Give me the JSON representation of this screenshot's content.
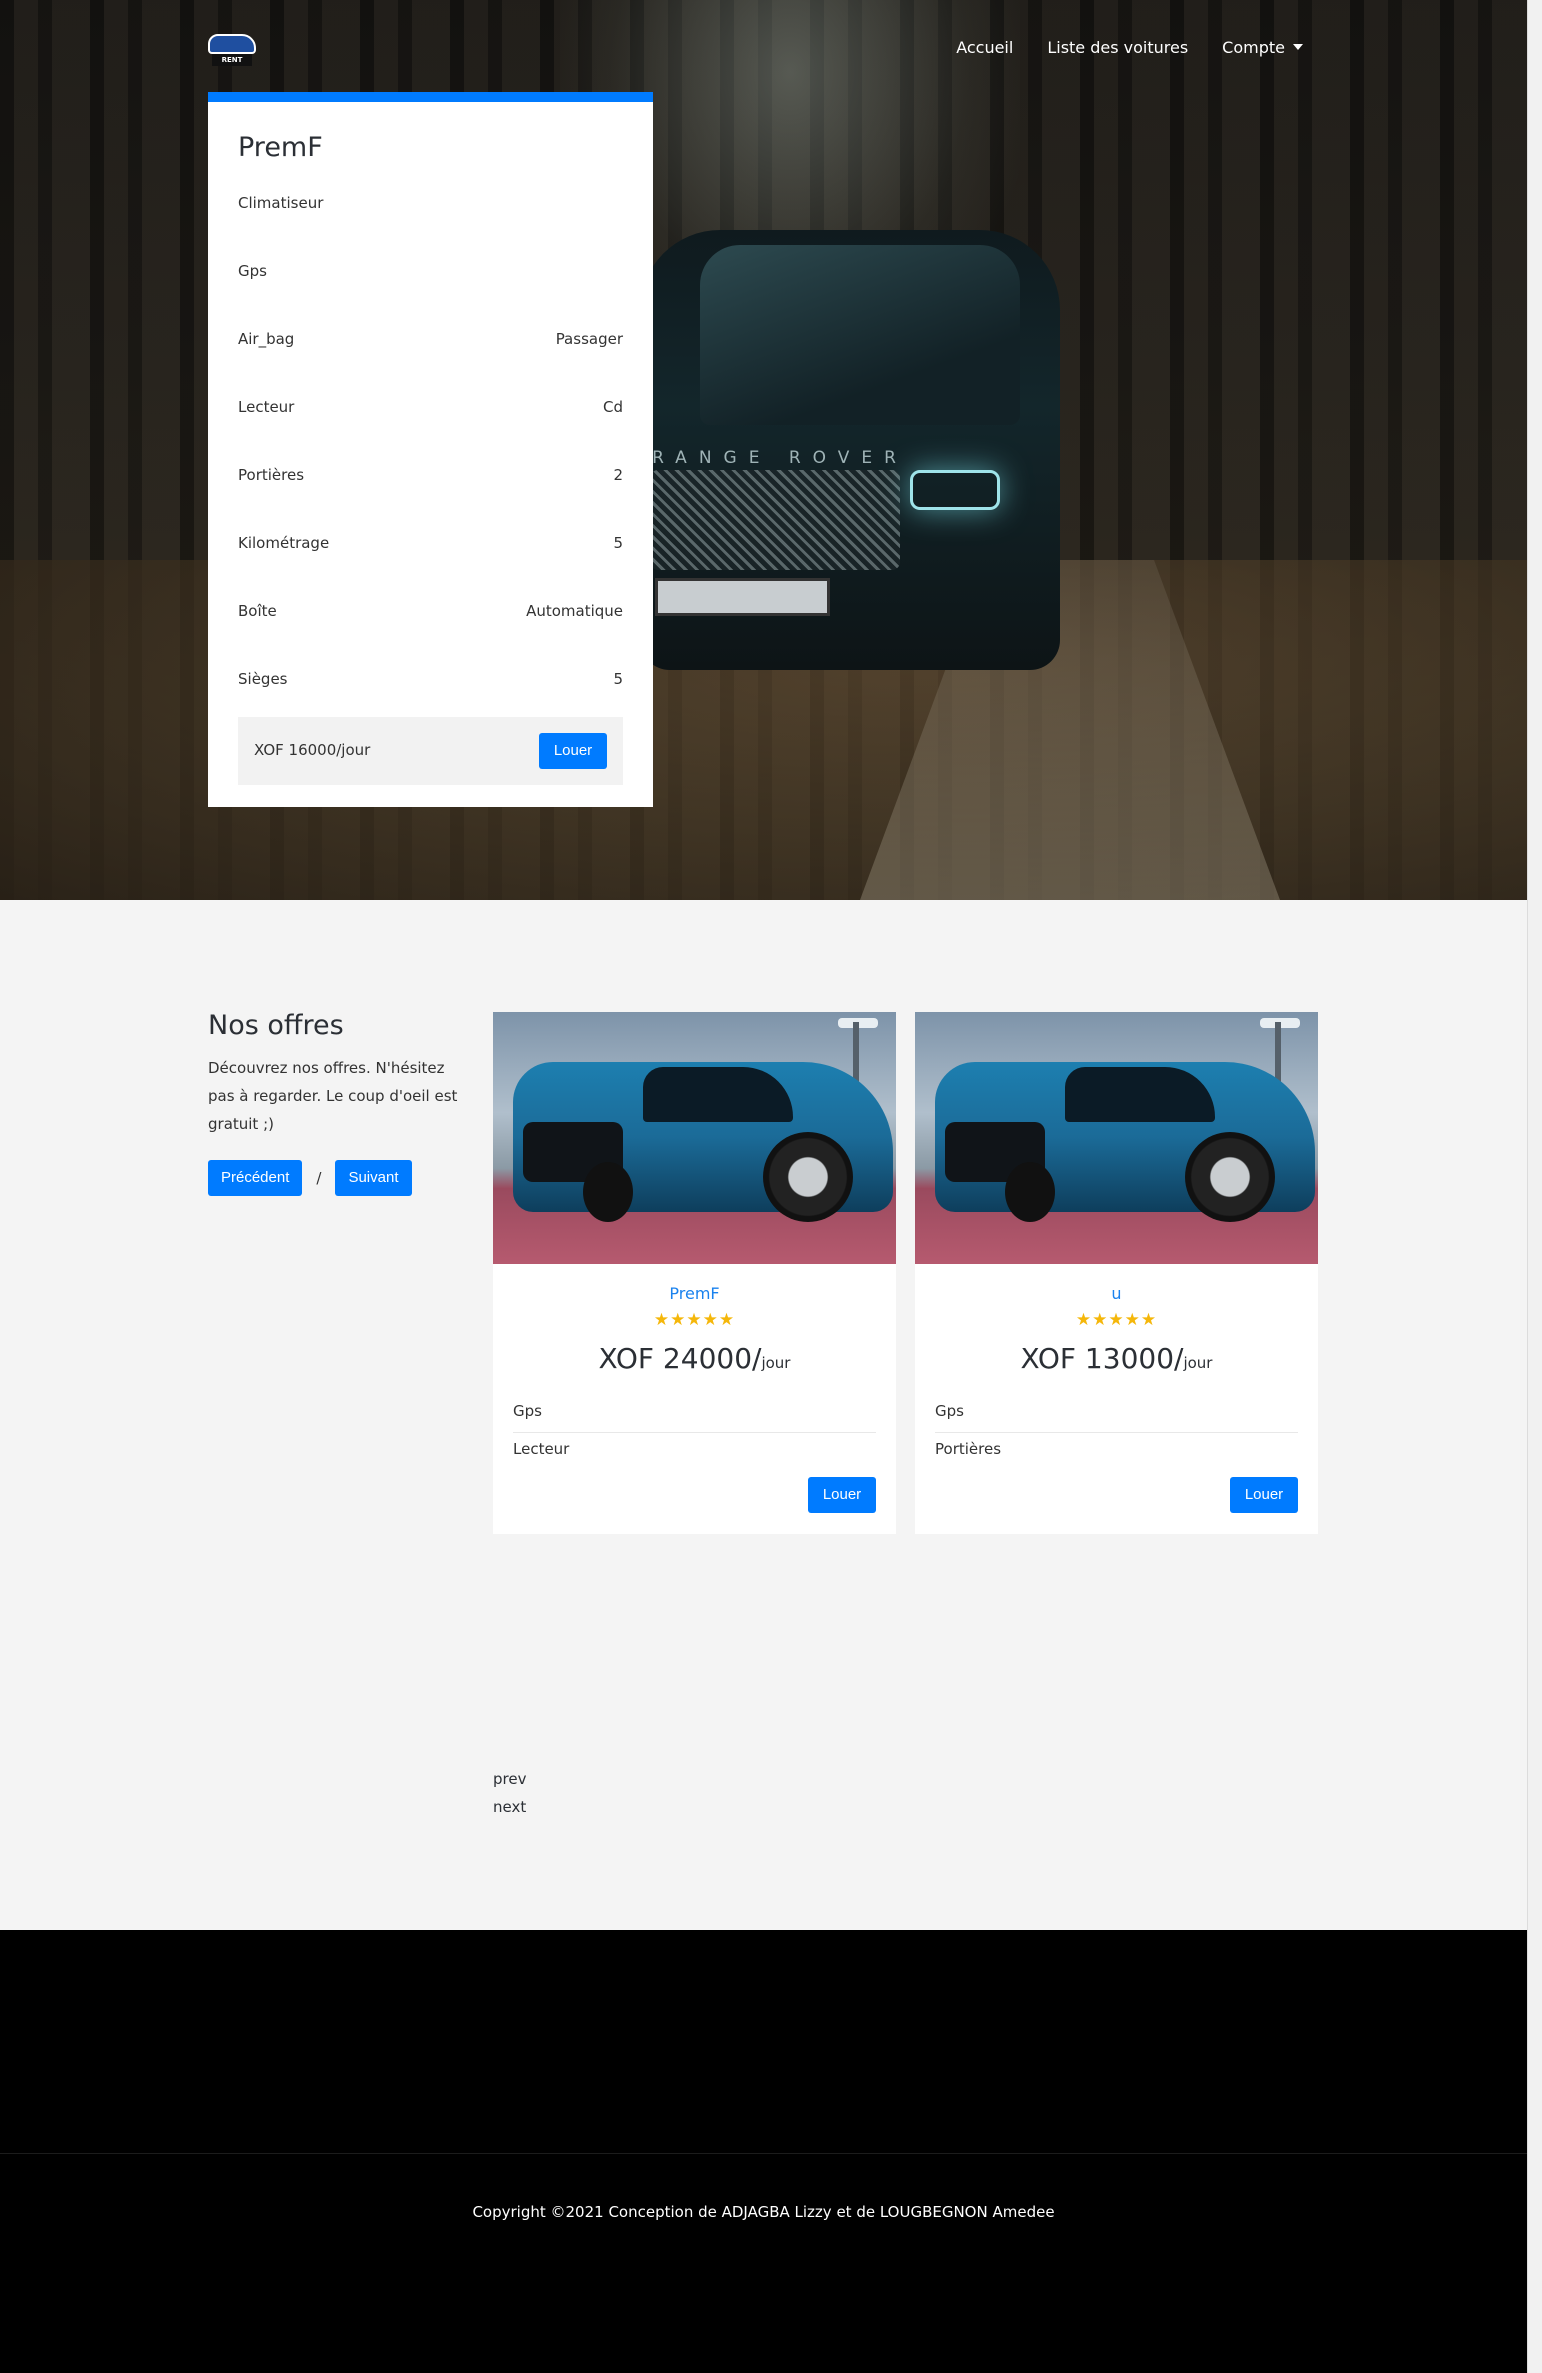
{
  "nav": {
    "logo_text": "RENT",
    "links": [
      "Accueil",
      "Liste des voitures",
      "Compte"
    ]
  },
  "hero": {
    "car_badge": "RANGE ROVER"
  },
  "spec_card": {
    "title": "PremF",
    "rows": [
      {
        "label": "Climatiseur",
        "value": ""
      },
      {
        "label": "Gps",
        "value": ""
      },
      {
        "label": "Air_bag",
        "value": "Passager"
      },
      {
        "label": "Lecteur",
        "value": "Cd"
      },
      {
        "label": "Portières",
        "value": "2"
      },
      {
        "label": "Kilométrage",
        "value": "5"
      },
      {
        "label": "Boîte",
        "value": "Automatique"
      },
      {
        "label": "Sièges",
        "value": "5"
      }
    ],
    "price": "XOF 16000/jour",
    "button": "Louer"
  },
  "offers": {
    "title": "Nos offres",
    "description": "Découvrez nos offres. N'hésitez pas à regarder. Le coup d'oeil est gratuit ;)",
    "prev_button": "Précédent",
    "separator": "/",
    "next_button": "Suivant",
    "cards": [
      {
        "name": "PremF",
        "stars": "★★★★★",
        "rating": 5,
        "price": "XOF 24000/",
        "unit": "jour",
        "features": [
          "Gps",
          "Lecteur"
        ],
        "button": "Louer"
      },
      {
        "name": "u",
        "stars": "★★★★★",
        "rating": 5,
        "price": "XOF 13000/",
        "unit": "jour",
        "features": [
          "Gps",
          "Portières"
        ],
        "button": "Louer"
      }
    ],
    "pagination": {
      "prev": "prev",
      "next": "next"
    }
  },
  "footer": {
    "copyright": "Copyright ©2021 Conception de ADJAGBA Lizzy et de LOUGBEGNON Amedee"
  },
  "colors": {
    "accent": "#007bff",
    "star": "#f5b70a",
    "offer_name": "#1a82ee",
    "section_bg": "#f4f4f4",
    "footer_bg": "#000000"
  }
}
